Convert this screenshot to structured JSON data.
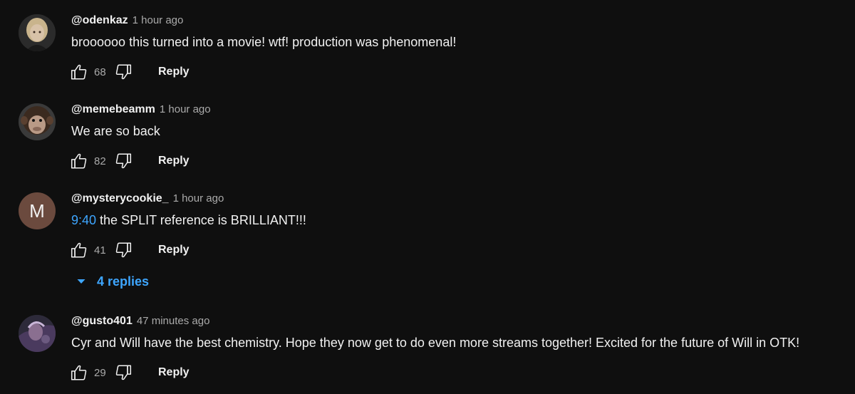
{
  "accent_color": "#3ea6ff",
  "comments": [
    {
      "handle": "@odenkaz",
      "time": "1 hour ago",
      "text": "broooooo this turned into a movie! wtf! production was phenomenal!",
      "likes": "68",
      "reply_label": "Reply"
    },
    {
      "handle": "@memebeamm",
      "time": "1 hour ago",
      "text": "We are so back",
      "likes": "82",
      "reply_label": "Reply"
    },
    {
      "handle": "@mysterycookie_",
      "time": "1 hour ago",
      "avatar_letter": "M",
      "timestamp_link": "9:40",
      "text": " the SPLIT reference is BRILLIANT!!!",
      "likes": "41",
      "reply_label": "Reply",
      "replies_label": "4 replies"
    },
    {
      "handle": "@gusto401",
      "time": "47 minutes ago",
      "text": "Cyr and Will have the best chemistry. Hope they now get to do even more streams together! Excited for the future of Will in OTK!",
      "likes": "29",
      "reply_label": "Reply"
    }
  ],
  "icons": {
    "like": "thumbs-up-icon",
    "dislike": "thumbs-down-icon",
    "expand": "caret-down-icon"
  }
}
